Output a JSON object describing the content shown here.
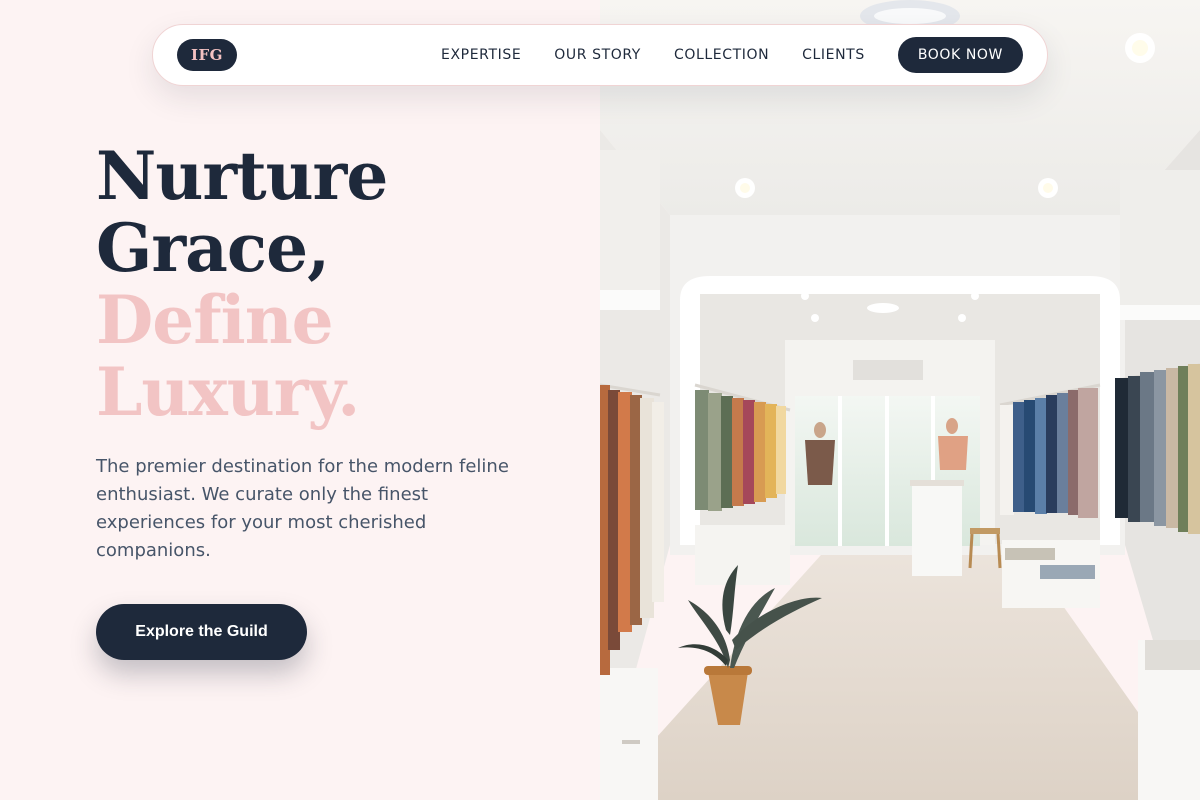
{
  "nav": {
    "logo": "IFG",
    "links": [
      "EXPERTISE",
      "OUR STORY",
      "COLLECTION",
      "CLIENTS"
    ],
    "cta_label": "BOOK NOW"
  },
  "hero": {
    "title_line_1": "Nurture",
    "title_line_2": "Grace,",
    "title_line_3": "Define",
    "title_line_4": "Luxury.",
    "subtitle": "The premier destination for the modern feline enthusiast. We curate only the finest experiences for your most cherished companions.",
    "cta_label": "Explore the Guild"
  },
  "image": {
    "subject": "boutique-interior"
  },
  "colors": {
    "background": "#fdf3f3",
    "navy": "#1e293b",
    "accent_pink": "#f2c4c4",
    "body_text": "#475569"
  }
}
